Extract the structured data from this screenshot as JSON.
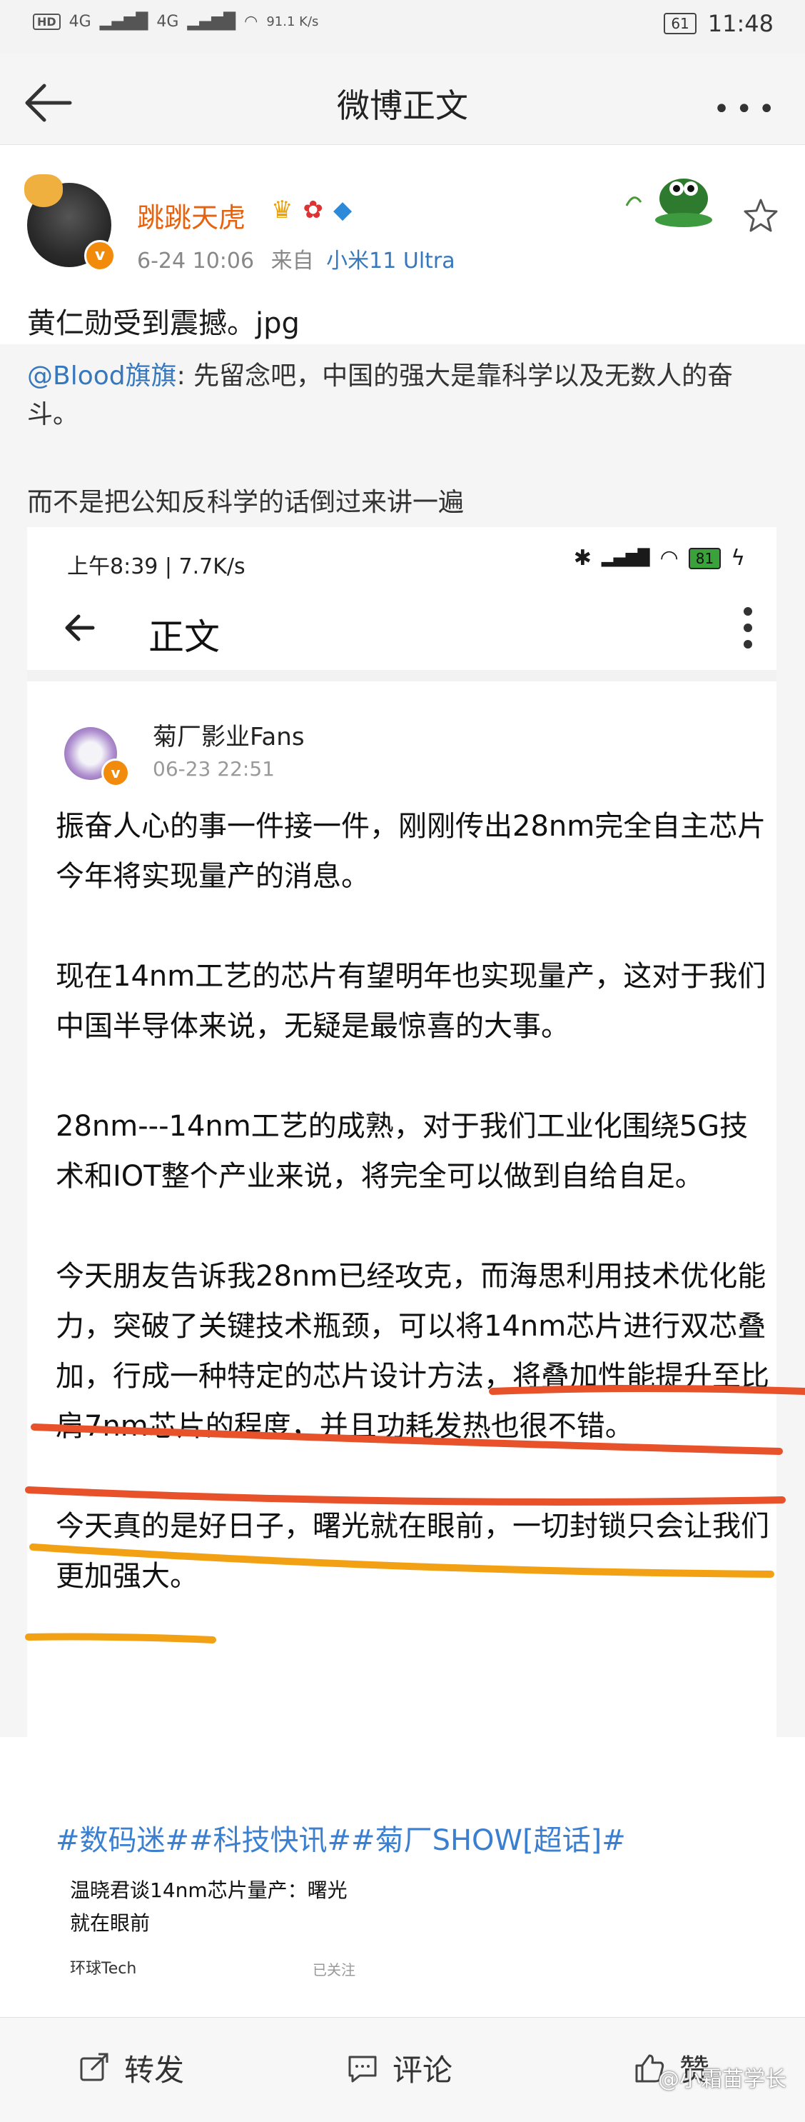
{
  "status_bar": {
    "hd_badge": "HD",
    "net1": "4G",
    "net2": "4G",
    "speed": "91.1 K/s",
    "battery": "61",
    "time": "11:48"
  },
  "nav": {
    "title": "微博正文"
  },
  "post": {
    "username": "跳跳天虎",
    "date": "6-24 10:06",
    "source_prefix": "来自",
    "source": "小米11 Ultra",
    "text": "黄仁勋受到震撼。jpg",
    "quote_mention": "@Blood旗旗",
    "quote_text": ": 先留念吧，中国的强大是靠科学以及无数人的奋斗。",
    "comment": "而不是把公知反科学的话倒过来讲一遍"
  },
  "shot": {
    "status_time": "上午8:39 | 7.7K/s",
    "status_battery": "81",
    "title": "正文",
    "author": "菊厂影业Fans",
    "time": "06-23 22:51",
    "paragraphs": [
      "振奋人心的事一件接一件，刚刚传出28nm完全自主芯片今年将实现量产的消息。",
      "现在14nm工艺的芯片有望明年也实现量产，这对于我们中国半导体来说，无疑是最惊喜的大事。",
      "28nm---14nm工艺的成熟，对于我们工业化围绕5G技术和IOT整个产业来说，将完全可以做到自给自足。",
      "今天朋友告诉我28nm已经攻克，而海思利用技术优化能力，突破了关键技术瓶颈，可以将14nm芯片进行双芯叠加，行成一种特定的芯片设计方法，将叠加性能提升至比肩7nm芯片的程度，并且功耗发热也很不错。",
      "今天真的是好日子，曙光就在眼前，一切封锁只会让我们更加强大。"
    ],
    "tags": "#数码迷##科技快讯##菊厂SHOW[超话]#",
    "card_title_1": "温晓君谈14nm芯片量产：曙光",
    "card_title_2": "就在眼前",
    "card_source": "环球Tech",
    "card_follow": "已关注"
  },
  "toolbar": {
    "repost": "转发",
    "comment": "评论",
    "like": "赞"
  },
  "watermark": "@小霜苗学长",
  "colors": {
    "username": "#e8620d",
    "link": "#3778bd",
    "underline_red": "#e8522a",
    "underline_orange": "#f2a114"
  }
}
